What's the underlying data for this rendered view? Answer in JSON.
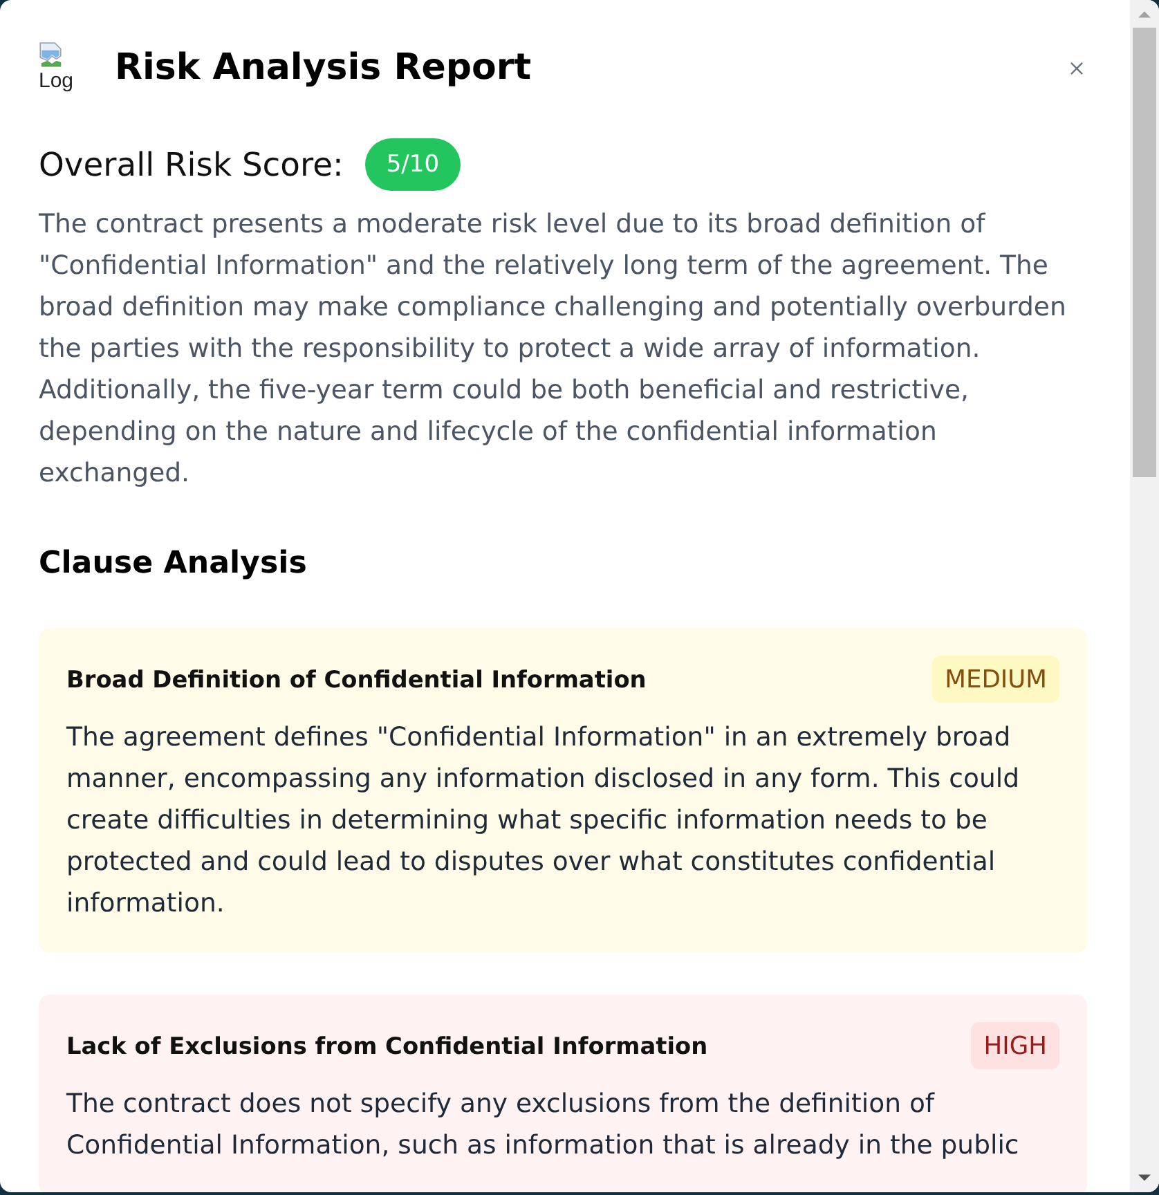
{
  "header": {
    "logo_alt_text": "Log",
    "title": "Risk Analysis Report"
  },
  "overall_risk": {
    "label": "Overall Risk Score:",
    "score": "5/10"
  },
  "summary": "The contract presents a moderate risk level due to its broad definition of \"Confidential Information\" and the relatively long term of the agreement. The broad definition may make compliance challenging and potentially overburden the parties with the responsibility to protect a wide array of information. Additionally, the five-year term could be both beneficial and restrictive, depending on the nature and lifecycle of the confidential information exchanged.",
  "clause_analysis": {
    "heading": "Clause Analysis",
    "clauses": [
      {
        "kind": "medium",
        "title": "Broad Definition of Confidential Information",
        "severity": "MEDIUM",
        "description": "The agreement defines \"Confidential Information\" in an extremely broad manner, encompassing any information disclosed in any form. This could create difficulties in determining what specific information needs to be protected and could lead to disputes over what constitutes confidential information."
      },
      {
        "kind": "high",
        "title": "Lack of Exclusions from Confidential Information",
        "severity": "HIGH",
        "description": "The contract does not specify any exclusions from the definition of Confidential Information, such as information that is already in the public"
      }
    ]
  }
}
